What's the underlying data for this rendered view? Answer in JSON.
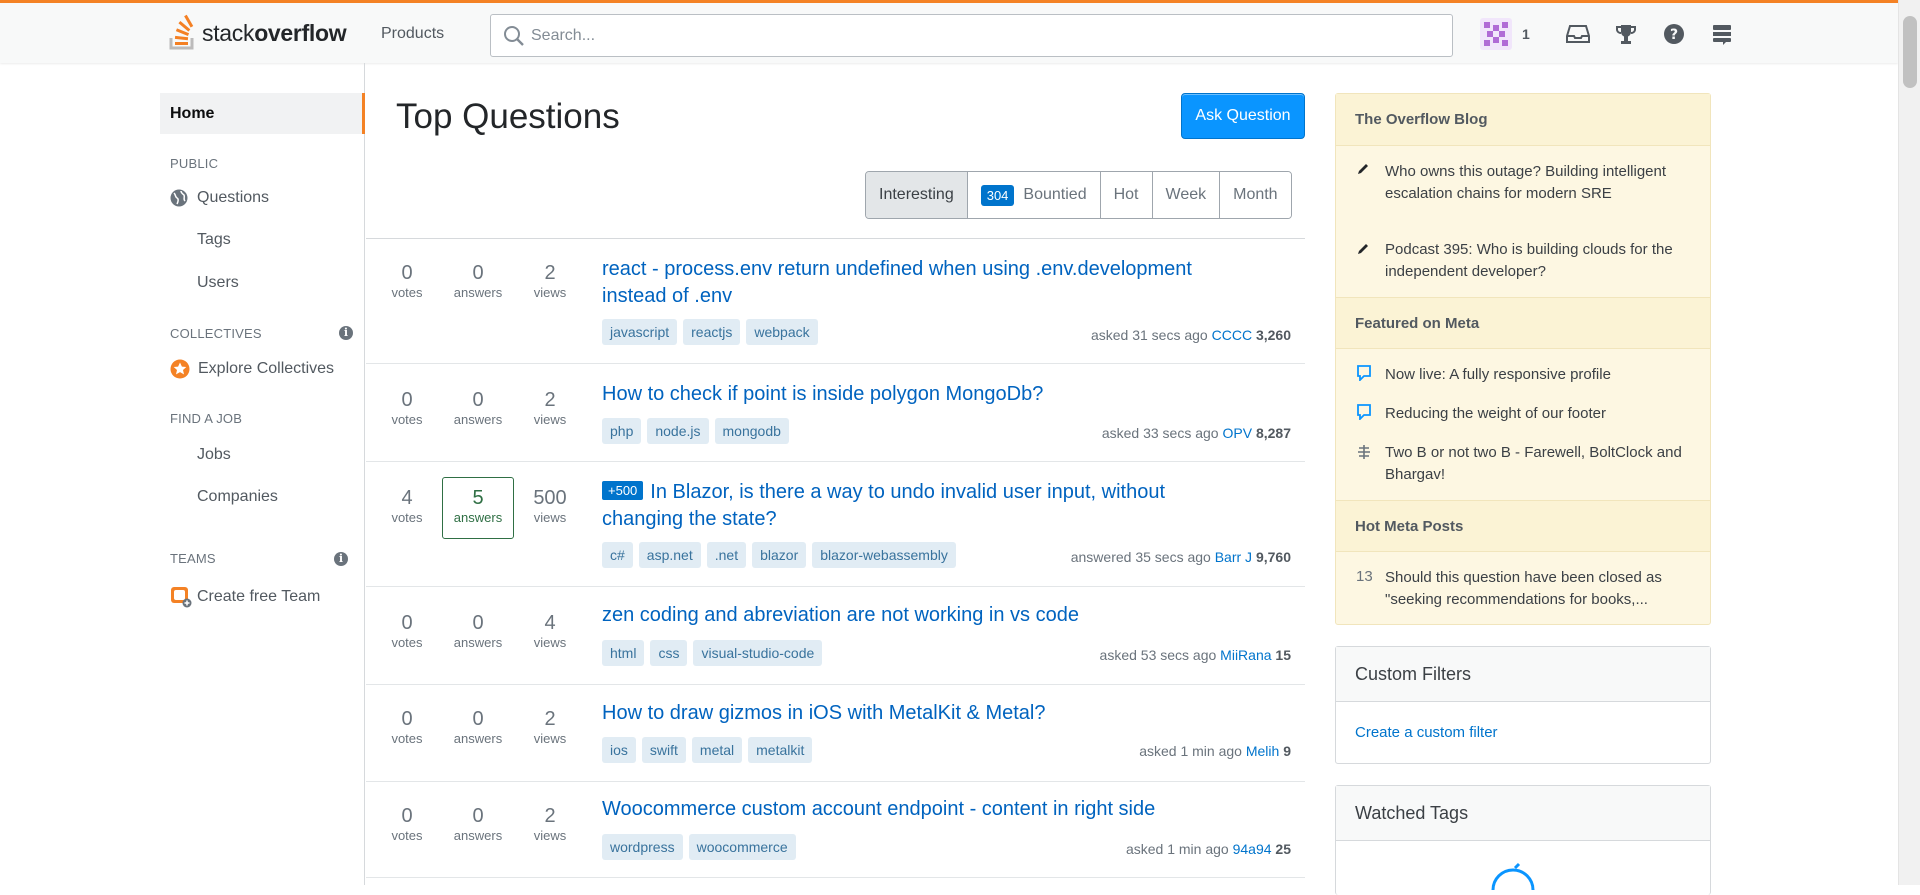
{
  "header": {
    "logo_light": "stack",
    "logo_bold": "overflow",
    "products": "Products",
    "search_placeholder": "Search...",
    "reputation": "1"
  },
  "leftnav": {
    "home": "Home",
    "public": "PUBLIC",
    "questions": "Questions",
    "tags": "Tags",
    "users": "Users",
    "collectives": "COLLECTIVES",
    "explore": "Explore Collectives",
    "find_job": "FIND A JOB",
    "jobs": "Jobs",
    "companies": "Companies",
    "teams": "TEAMS",
    "create_team": "Create free Team",
    "info": "i"
  },
  "main": {
    "title": "Top Questions",
    "ask": "Ask Question",
    "filters": {
      "interesting": "Interesting",
      "bounty_count": "304",
      "bountied": "Bountied",
      "hot": "Hot",
      "week": "Week",
      "month": "Month"
    },
    "questions": [
      {
        "votes": "0",
        "votes_l": "votes",
        "answers": "0",
        "answers_l": "answers",
        "views": "2",
        "views_l": "views",
        "title": "react - process.env return undefined when using .env.development instead of .env",
        "bounty": "",
        "tags": [
          "javascript",
          "reactjs",
          "webpack"
        ],
        "action": "asked 31 secs ago",
        "user": "CCCC",
        "rep": "3,260"
      },
      {
        "votes": "0",
        "votes_l": "votes",
        "answers": "0",
        "answers_l": "answers",
        "views": "2",
        "views_l": "views",
        "title": "How to check if point is inside polygon MongoDb?",
        "bounty": "",
        "tags": [
          "php",
          "node.js",
          "mongodb"
        ],
        "action": "asked 33 secs ago",
        "user": "OPV",
        "rep": "8,287"
      },
      {
        "votes": "4",
        "votes_l": "votes",
        "answers": "5",
        "answers_l": "answers",
        "views": "500",
        "views_l": "views",
        "title": "In Blazor, is there a way to undo invalid user input, without changing the state?",
        "bounty": "+500",
        "tags": [
          "c#",
          "asp.net",
          ".net",
          "blazor",
          "blazor-webassembly"
        ],
        "action": "answered 35 secs ago",
        "user": "Barr J",
        "rep": "9,760"
      },
      {
        "votes": "0",
        "votes_l": "votes",
        "answers": "0",
        "answers_l": "answers",
        "views": "4",
        "views_l": "views",
        "title": "zen coding and abreviation are not working in vs code",
        "bounty": "",
        "tags": [
          "html",
          "css",
          "visual-studio-code"
        ],
        "action": "asked 53 secs ago",
        "user": "MiiRana",
        "rep": "15"
      },
      {
        "votes": "0",
        "votes_l": "votes",
        "answers": "0",
        "answers_l": "answers",
        "views": "2",
        "views_l": "views",
        "title": "How to draw gizmos in iOS with MetalKit & Metal?",
        "bounty": "",
        "tags": [
          "ios",
          "swift",
          "metal",
          "metalkit"
        ],
        "action": "asked 1 min ago",
        "user": "Melih",
        "rep": "9"
      },
      {
        "votes": "0",
        "votes_l": "votes",
        "answers": "0",
        "answers_l": "answers",
        "views": "2",
        "views_l": "views",
        "title": "Woocommerce custom account endpoint - content in right side",
        "bounty": "",
        "tags": [
          "wordpress",
          "woocommerce"
        ],
        "action": "asked 1 min ago",
        "user": "94a94",
        "rep": "25"
      }
    ]
  },
  "sidebar": {
    "blog_title": "The Overflow Blog",
    "blog1": "Who owns this outage? Building intelligent escalation chains for modern SRE",
    "blog2": "Podcast 395: Who is building clouds for the independent developer?",
    "meta_title": "Featured on Meta",
    "meta1": "Now live: A fully responsive profile",
    "meta2": "Reducing the weight of our footer",
    "meta3": "Two B or not two B - Farewell, BoltClock and Bhargav!",
    "hot_title": "Hot Meta Posts",
    "hot_num": "13",
    "hot1": "Should this question have been closed as \"seeking recommendations for books,...",
    "custom_filters": "Custom Filters",
    "create_filter": "Create a custom filter",
    "watched_tags": "Watched Tags"
  },
  "colors": {
    "accent": "#f48225",
    "link": "#0074cc",
    "button": "#0a95ff"
  }
}
